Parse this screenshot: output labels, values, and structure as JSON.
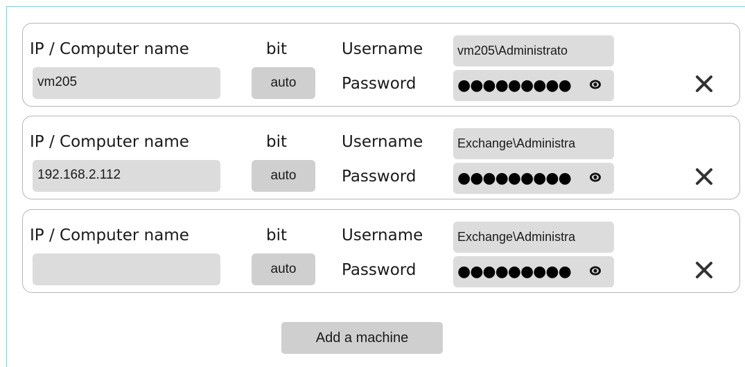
{
  "labels": {
    "ip": "IP / Computer name",
    "bit": "bit",
    "username": "Username",
    "password": "Password"
  },
  "machines": [
    {
      "ip": "vm205",
      "bit": "auto",
      "username": "vm205\\Administrato",
      "password": "●●●●●●●●●"
    },
    {
      "ip": "192.168.2.112",
      "bit": "auto",
      "username": "Exchange\\Administra",
      "password": "●●●●●●●●●"
    },
    {
      "ip": "",
      "bit": "auto",
      "username": "Exchange\\Administra",
      "password": "●●●●●●●●●"
    }
  ],
  "add_button": "Add a machine",
  "icons": {
    "reveal": "eye-icon",
    "remove": "close-icon"
  },
  "colors": {
    "frame": "#7fcde0",
    "field": "#dcdcdc",
    "button": "#cfcfcf"
  }
}
